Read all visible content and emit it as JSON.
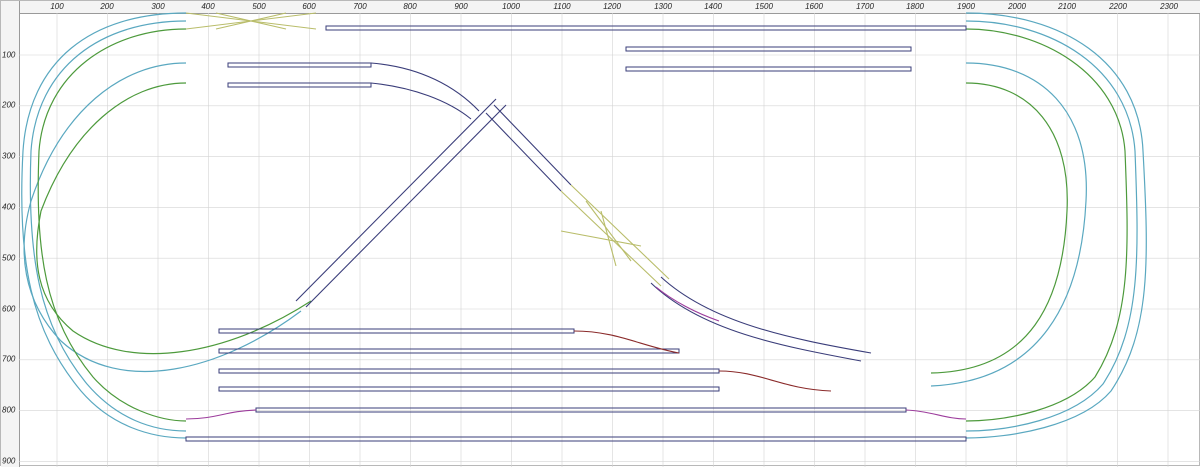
{
  "ruler": {
    "x_ticks": [
      "100",
      "200",
      "300",
      "400",
      "500",
      "600",
      "700",
      "800",
      "900",
      "1000",
      "1100",
      "1200",
      "1300",
      "1400",
      "1500",
      "1600",
      "1700",
      "1800",
      "1900",
      "2000",
      "2100",
      "2200",
      "2300"
    ],
    "y_ticks": [
      "100",
      "200",
      "300",
      "400",
      "500",
      "600",
      "700",
      "800",
      "900"
    ]
  },
  "colors": {
    "grid": "#d4d4d4",
    "outer_loop": "#5aa8c0",
    "inner_loop": "#4d9a3c",
    "straight_track": "#3a3d7a",
    "turnout": "#b9bd6a",
    "curved_turnout": "#9c3c9c",
    "siding_curve": "#8a2a2a"
  },
  "plan": {
    "tracks": [
      "outer-loop",
      "inner-loop",
      "figure-eight-crossing",
      "yard-sidings",
      "passing-sidings",
      "top-crossover"
    ]
  }
}
